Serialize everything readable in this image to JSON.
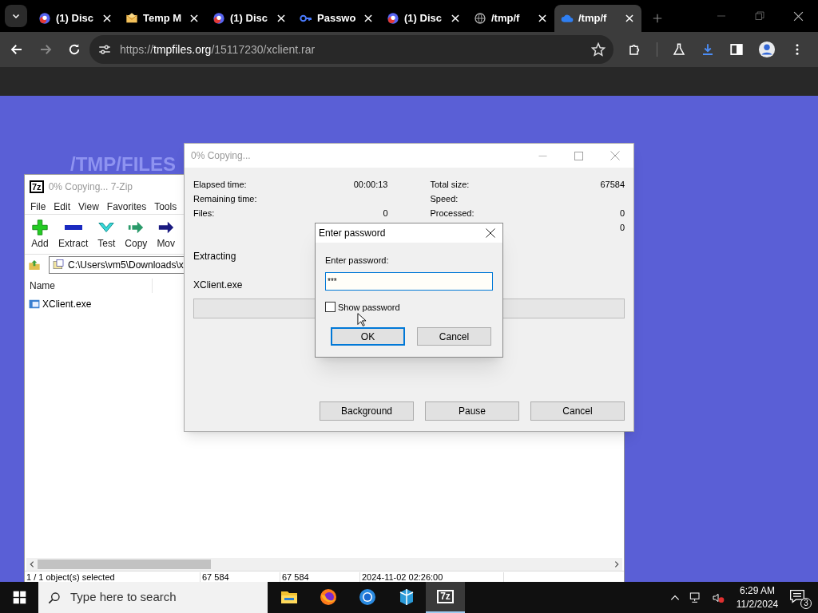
{
  "browser": {
    "tabs": [
      {
        "title": "(1) Disc",
        "kind": "chat",
        "selected": false
      },
      {
        "title": "Temp M",
        "kind": "mail",
        "selected": false
      },
      {
        "title": "(1) Disc",
        "kind": "chat",
        "selected": false
      },
      {
        "title": "Passwo",
        "kind": "key",
        "selected": false
      },
      {
        "title": "(1) Disc",
        "kind": "chat",
        "selected": false
      },
      {
        "title": "/tmp/f",
        "kind": "globe",
        "selected": false
      },
      {
        "title": "/tmp/f",
        "kind": "cloud",
        "selected": true
      }
    ],
    "url": {
      "scheme": "https://",
      "host": "tmpfiles.org",
      "path": "/15117230/xclient.rar"
    }
  },
  "page": {
    "heading": "/TMP/FILES"
  },
  "file_manager": {
    "logo": "7z",
    "title": "0% Copying... 7-Zip",
    "active": false,
    "menu": [
      "File",
      "Edit",
      "View",
      "Favorites",
      "Tools"
    ],
    "toolbar": [
      {
        "label": "Add",
        "kind": "add"
      },
      {
        "label": "Extract",
        "kind": "extract"
      },
      {
        "label": "Test",
        "kind": "test"
      },
      {
        "label": "Copy",
        "kind": "copy"
      },
      {
        "label": "Mov",
        "kind": "move"
      }
    ],
    "path": "C:\\Users\\vm5\\Downloads\\x",
    "columns": [
      "Name"
    ],
    "rows": [
      {
        "name": "XClient.exe",
        "selected": false
      }
    ],
    "status_bar": [
      "1 / 1 object(s) selected",
      "67 584",
      "67 584",
      "2024-11-02 02:26:00"
    ]
  },
  "progress_dialog": {
    "title": "0% Copying...",
    "active": false,
    "stats_left": [
      {
        "label": "Elapsed time:",
        "value": "00:00:13"
      },
      {
        "label": "Remaining time:"
      },
      {
        "label": "Files:",
        "value": "0"
      }
    ],
    "stats_right": [
      {
        "label": "Total size:",
        "value": "67584"
      },
      {
        "label": "Speed:"
      },
      {
        "label": "Processed:",
        "value": "0"
      },
      {
        "value": "0"
      }
    ],
    "operation": "Extracting",
    "file": "XClient.exe",
    "progress": {
      "level": 0
    },
    "buttons": [
      "Background",
      "Pause",
      "Cancel"
    ]
  },
  "password_dialog": {
    "title": "Enter password",
    "active": true,
    "label": "Enter password:",
    "value": "***",
    "show_password": {
      "label": "Show password",
      "checked": false
    },
    "buttons": [
      {
        "label": "OK",
        "default": true
      },
      {
        "label": "Cancel",
        "default": false
      }
    ]
  },
  "taskbar": {
    "search_placeholder": "Type here to search",
    "apps": [
      {
        "kind": "folder",
        "selected": false
      },
      {
        "kind": "firefox",
        "selected": false
      },
      {
        "kind": "chrome",
        "selected": false
      },
      {
        "kind": "cube",
        "selected": false
      },
      {
        "kind": "sevenzip",
        "label": "7z",
        "selected": true
      }
    ],
    "time": "6:29 AM",
    "date": "11/2/2024",
    "notifications": "3"
  }
}
